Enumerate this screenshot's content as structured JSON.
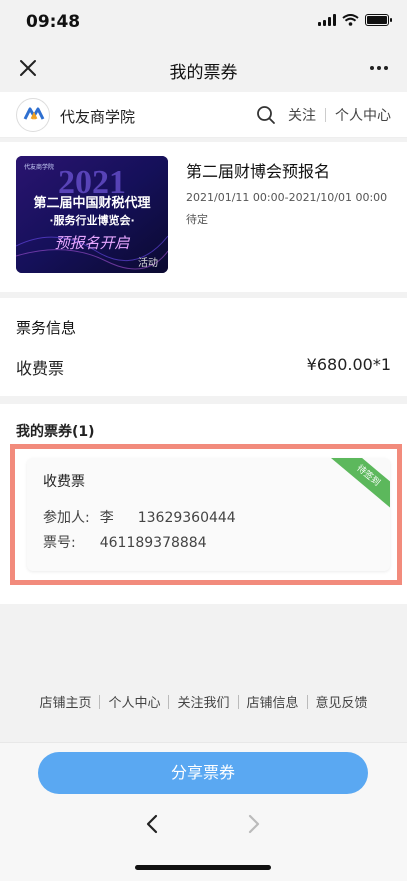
{
  "status": {
    "time": "09:48"
  },
  "nav": {
    "title": "我的票券"
  },
  "shop": {
    "name": "代友商学院",
    "logo_text": "代友商学院",
    "follow_label": "关注",
    "center_label": "个人中心"
  },
  "event": {
    "title": "第二届财博会预报名",
    "date": "2021/01/11 00:00-2021/10/01 00:00",
    "status": "待定",
    "poster": {
      "year": "2021",
      "brand": "代友商学院",
      "line1": "第二届中国财税代理",
      "line2": "·服务行业博览会·",
      "line3": "预报名开启",
      "tag": "活动"
    }
  },
  "ticket_info": {
    "heading": "票务信息",
    "ticket_name": "收费票",
    "price": "¥680.00*1"
  },
  "my_tickets": {
    "heading": "我的票券(1)",
    "ticket": {
      "name": "收费票",
      "attendee_label": "参加人:",
      "attendee_name": "李",
      "attendee_phone": "13629360444",
      "number_label": "票号:",
      "number": "461189378884",
      "badge": "待签到"
    }
  },
  "footer": {
    "links": [
      "店铺主页",
      "个人中心",
      "关注我们",
      "店铺信息",
      "意见反馈"
    ]
  },
  "actions": {
    "share_label": "分享票券"
  },
  "colors": {
    "accent": "#5aa8f2",
    "highlight": "#f28b7c",
    "badge": "#5cb85c"
  }
}
